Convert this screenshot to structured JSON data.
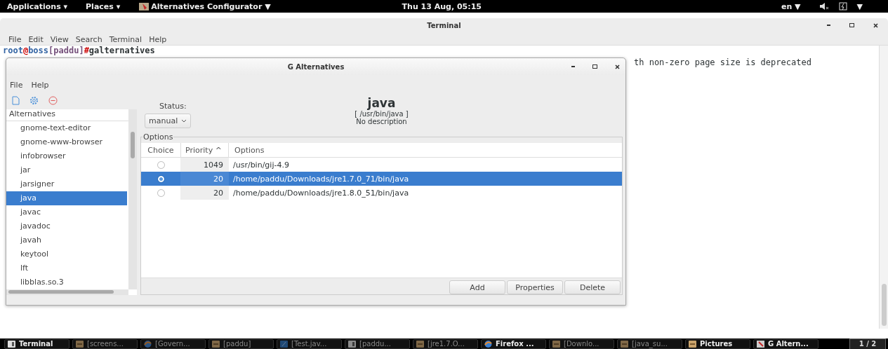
{
  "top_bar": {
    "menus": [
      {
        "label": "Applications",
        "caret": "▾"
      },
      {
        "label": "Places",
        "caret": "▾"
      }
    ],
    "app_menu": {
      "label": "Alternatives Configurator",
      "caret": "▼"
    },
    "clock": "Thu 13 Aug, 05:15",
    "input_source": {
      "label": "en",
      "caret": "▼"
    },
    "status_caret": "▼"
  },
  "terminal": {
    "title": "Terminal",
    "menu": [
      "File",
      "Edit",
      "View",
      "Search",
      "Terminal",
      "Help"
    ],
    "prompt": [
      {
        "text": "root",
        "color": "#3465a4"
      },
      {
        "text": "@",
        "color": "#cc0000"
      },
      {
        "text": "boss",
        "color": "#3465a4"
      },
      {
        "text": "[paddu]",
        "color": "#75507b"
      },
      {
        "text": "#",
        "color": "#cc0000"
      },
      {
        "text": "galternatives",
        "color": "#2e3436"
      }
    ],
    "output": "th non-zero page size is deprecated"
  },
  "dialog": {
    "title": "G Alternatives",
    "menu": [
      "File",
      "Help"
    ],
    "sidebar": {
      "header": "Alternatives",
      "items": [
        {
          "label": "gnome-text-editor",
          "selected": false
        },
        {
          "label": "gnome-www-browser",
          "selected": false
        },
        {
          "label": "infobrowser",
          "selected": false
        },
        {
          "label": "jar",
          "selected": false
        },
        {
          "label": "jarsigner",
          "selected": false
        },
        {
          "label": "java",
          "selected": true
        },
        {
          "label": "javac",
          "selected": false
        },
        {
          "label": "javadoc",
          "selected": false
        },
        {
          "label": "javah",
          "selected": false
        },
        {
          "label": "keytool",
          "selected": false
        },
        {
          "label": "lft",
          "selected": false
        },
        {
          "label": "libblas.so.3",
          "selected": false
        }
      ]
    },
    "status_label": "Status:",
    "status_value": "manual",
    "name": "java",
    "path": "[ /usr/bin/java ]",
    "description": "No description",
    "options": {
      "legend": "Options",
      "columns": [
        "Choice",
        "Priority ^",
        "Options"
      ],
      "rows": [
        {
          "priority": "1049",
          "path": "/usr/bin/gij-4.9",
          "chosen": false,
          "selected": false
        },
        {
          "priority": "20",
          "path": "/home/paddu/Downloads/jre1.7.0_71/bin/java",
          "chosen": true,
          "selected": true
        },
        {
          "priority": "20",
          "path": "/home/paddu/Downloads/jre1.8.0_51/bin/java",
          "chosen": false,
          "selected": false
        }
      ]
    },
    "buttons": [
      "Add",
      "Properties",
      "Delete"
    ]
  },
  "taskbar": {
    "items": [
      {
        "label": "Terminal",
        "kind": "terminal",
        "minimized": false
      },
      {
        "label": "[screens...",
        "kind": "folder",
        "minimized": true
      },
      {
        "label": "[Govern...",
        "kind": "browser",
        "minimized": true
      },
      {
        "label": "[paddu]",
        "kind": "folder",
        "minimized": true
      },
      {
        "label": "[Test.jav...",
        "kind": "editor",
        "minimized": true
      },
      {
        "label": "[paddu...",
        "kind": "terminal",
        "minimized": true
      },
      {
        "label": "[jre1.7.O...",
        "kind": "folder",
        "minimized": true
      },
      {
        "label": "Firefox ...",
        "kind": "browser",
        "minimized": false
      },
      {
        "label": "[Downlo...",
        "kind": "folder",
        "minimized": true
      },
      {
        "label": "[java_su...",
        "kind": "folder",
        "minimized": true
      },
      {
        "label": "Pictures",
        "kind": "folder",
        "minimized": false
      },
      {
        "label": "G Altern...",
        "kind": "app",
        "minimized": false
      }
    ],
    "pager": "1 / 2"
  }
}
